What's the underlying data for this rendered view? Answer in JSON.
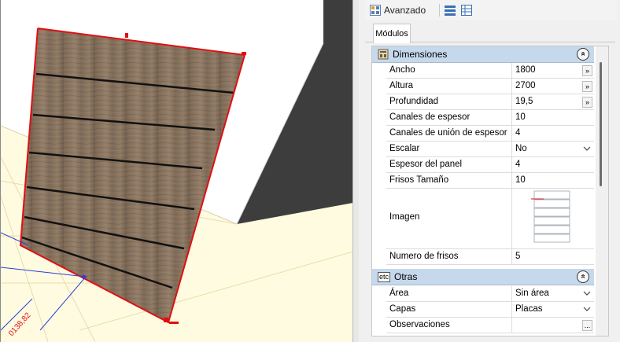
{
  "toolbar": {
    "advanced_label": "Avanzado",
    "icons": [
      "advanced-grid-icon",
      "list-view-icon",
      "table-view-icon"
    ]
  },
  "tabs": [
    {
      "label": "Módulos",
      "active": true
    }
  ],
  "sections": [
    {
      "label": "Dimensiones",
      "icon": "dimensions-icon",
      "rows": [
        {
          "key": "Ancho",
          "value": "1800",
          "button": "»"
        },
        {
          "key": "Altura",
          "value": "2700",
          "button": "»"
        },
        {
          "key": "Profundidad",
          "value": "19,5",
          "button": "»"
        },
        {
          "key": "Canales de espesor",
          "value": "10"
        },
        {
          "key": "Canales de unión de espesor",
          "value": "4"
        },
        {
          "key": "Escalar",
          "value": "No",
          "combo": true
        },
        {
          "key": "Espesor del panel",
          "value": "4"
        },
        {
          "key": "Frisos Tamaño",
          "value": "10"
        },
        {
          "key": "Imagen",
          "value": ""
        },
        {
          "key": "Numero de frisos",
          "value": "5"
        }
      ]
    },
    {
      "label": "Otras",
      "icon": "etc-icon",
      "icon_text": "etc",
      "rows": [
        {
          "key": "Área",
          "value": "Sin área",
          "combo": true
        },
        {
          "key": "Capas",
          "value": "Placas",
          "combo": true
        },
        {
          "key": "Observaciones",
          "value": "",
          "button": "..."
        }
      ]
    }
  ],
  "collapse_glyph": "»",
  "viewport": {
    "dimension_text": "0138,82",
    "colors": {
      "panel_wood": "#8a7460",
      "edge_red": "#e01010",
      "floor": "#fffbe0",
      "background": "#3d3d3d"
    }
  }
}
